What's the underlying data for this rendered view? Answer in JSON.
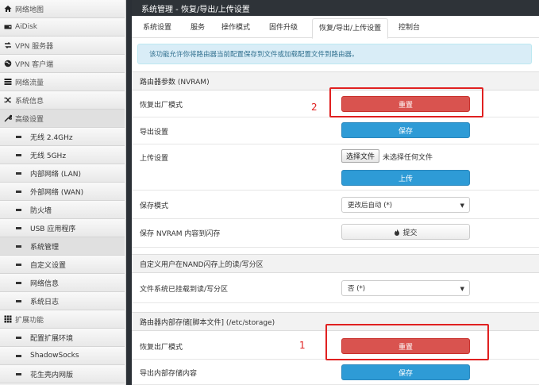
{
  "sidebar": {
    "items": [
      {
        "label": "网络地图",
        "icon": "home-icon",
        "type": "top"
      },
      {
        "label": "AiDisk",
        "icon": "hdd-icon",
        "type": "top"
      },
      {
        "label": "VPN 服务器",
        "icon": "vpn-server-icon",
        "type": "top"
      },
      {
        "label": "VPN 客户端",
        "icon": "globe-icon",
        "type": "top"
      },
      {
        "label": "网络流量",
        "icon": "list-icon",
        "type": "top"
      },
      {
        "label": "系统信息",
        "icon": "shuffle-icon",
        "type": "top"
      },
      {
        "label": "高级设置",
        "icon": "wrench-icon",
        "type": "top"
      },
      {
        "label": "无线 2.4GHz",
        "type": "sub"
      },
      {
        "label": "无线 5GHz",
        "type": "sub"
      },
      {
        "label": "内部网络 (LAN)",
        "type": "sub"
      },
      {
        "label": "外部网络 (WAN)",
        "type": "sub"
      },
      {
        "label": "防火墙",
        "type": "sub"
      },
      {
        "label": "USB 应用程序",
        "type": "sub"
      },
      {
        "label": "系统管理",
        "type": "sub"
      },
      {
        "label": "自定义设置",
        "type": "sub"
      },
      {
        "label": "网络信息",
        "type": "sub"
      },
      {
        "label": "系统日志",
        "type": "sub"
      },
      {
        "label": "扩展功能",
        "icon": "grid-icon",
        "type": "top"
      },
      {
        "label": "配置扩展环境",
        "type": "sub"
      },
      {
        "label": "ShadowSocks",
        "type": "sub"
      },
      {
        "label": "花生壳内网版",
        "type": "sub"
      }
    ]
  },
  "page": {
    "title": "系统管理 - 恢复/导出/上传设置",
    "tabs": [
      "系统设置",
      "服务",
      "操作模式",
      "固件升级",
      "恢复/导出/上传设置",
      "控制台"
    ],
    "info": "该功能允许你将路由器当前配置保存到文件或加载配置文件到路由器。"
  },
  "nvram": {
    "header": "路由器参数 (NVRAM)",
    "reset_label": "恢复出厂模式",
    "reset_btn": "重置",
    "export_label": "导出设置",
    "export_btn": "保存",
    "upload_label": "上传设置",
    "choose_file": "选择文件",
    "no_file": "未选择任何文件",
    "upload_btn": "上传",
    "save_mode_label": "保存模式",
    "save_mode_value": "更改后自动 (*)",
    "save_flash_label": "保存 NVRAM 内容到闪存",
    "commit_btn": "提交"
  },
  "nand": {
    "header": "自定义用户在NAND闪存上的读/写分区",
    "fs_label": "文件系统已挂载到读/写分区",
    "fs_value": "否 (*)"
  },
  "storage": {
    "header": "路由器内部存储[脚本文件] (/etc/storage)",
    "reset_label": "恢复出厂模式",
    "reset_btn": "重置",
    "export_label": "导出内部存储内容",
    "export_btn": "保存"
  },
  "annotations": {
    "one": "1",
    "two": "2"
  },
  "colors": {
    "danger": "#d9534f",
    "primary": "#2e9bd6",
    "highlight": "#e02020",
    "info_bg": "#d9edf7"
  }
}
